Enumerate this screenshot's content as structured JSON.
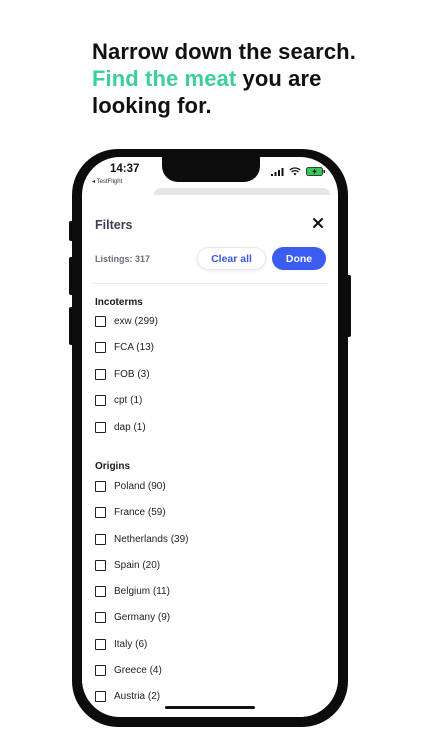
{
  "headline": {
    "line1": "Narrow down the search.",
    "accent": "Find the meat",
    "rest": " you are",
    "line3": "looking for."
  },
  "status": {
    "time": "14:37",
    "back_label": "◂ TestFlight"
  },
  "filters": {
    "title": "Filters",
    "listings": "Listings: 317",
    "clear_label": "Clear all",
    "done_label": "Done"
  },
  "incoterms": {
    "heading": "Incoterms",
    "items": [
      "exw (299)",
      "FCA (13)",
      "FOB (3)",
      "cpt (1)",
      "dap (1)"
    ]
  },
  "origins": {
    "heading": "Origins",
    "items": [
      "Poland (90)",
      "France (59)",
      "Netherlands (39)",
      "Spain (20)",
      "Belgium (11)",
      "Germany (9)",
      "Italy (6)",
      "Greece (4)",
      "Austria (2)"
    ]
  },
  "colors": {
    "accent_green": "#3ccf9b",
    "primary_blue": "#3b5cf0"
  }
}
